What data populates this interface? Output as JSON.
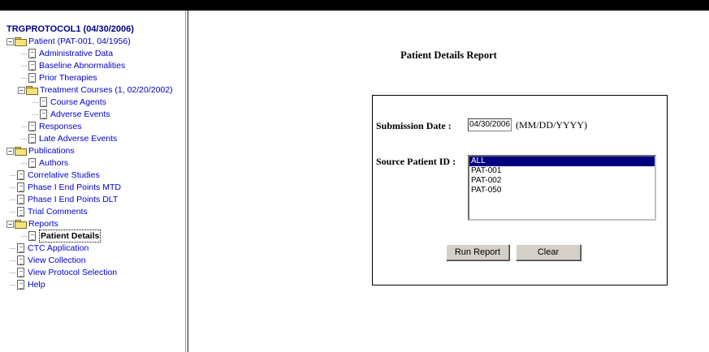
{
  "tree": {
    "title": "TRGPROTOCOL1 (04/30/2006)",
    "items": [
      {
        "label": "Patient (PAT-001, 04/1956)",
        "type": "folder",
        "level": 0,
        "expander": "−"
      },
      {
        "label": "Administrative Data",
        "type": "doc",
        "level": 1
      },
      {
        "label": "Baseline Abnormalities",
        "type": "doc",
        "level": 1
      },
      {
        "label": "Prior Therapies",
        "type": "doc",
        "level": 1
      },
      {
        "label": "Treatment Courses (1, 02/20/2002)",
        "type": "folder",
        "level": 1,
        "expander": "−"
      },
      {
        "label": "Course Agents",
        "type": "doc",
        "level": 2
      },
      {
        "label": "Adverse Events",
        "type": "doc",
        "level": 2
      },
      {
        "label": "Responses",
        "type": "doc",
        "level": 1
      },
      {
        "label": "Late Adverse Events",
        "type": "doc",
        "level": 1
      },
      {
        "label": "Publications",
        "type": "folder",
        "level": 0,
        "expander": "−"
      },
      {
        "label": "Authors",
        "type": "doc",
        "level": 1
      },
      {
        "label": "Correlative Studies",
        "type": "doc",
        "level": 0
      },
      {
        "label": "Phase I End Points MTD",
        "type": "doc",
        "level": 0
      },
      {
        "label": "Phase I End Points DLT",
        "type": "doc",
        "level": 0
      },
      {
        "label": "Trial Comments",
        "type": "doc",
        "level": 0
      },
      {
        "label": "Reports",
        "type": "folder",
        "level": 0,
        "expander": "−"
      },
      {
        "label": "Patient Details",
        "type": "doc",
        "level": 1,
        "selected": true
      },
      {
        "label": "CTC Application",
        "type": "doc",
        "level": 0
      },
      {
        "label": "View Collection",
        "type": "doc",
        "level": 0
      },
      {
        "label": "View Protocol Selection",
        "type": "doc",
        "level": 0
      },
      {
        "label": "Help",
        "type": "doc",
        "level": 0
      }
    ]
  },
  "report": {
    "title": "Patient Details Report",
    "submission_date_label": "Submission Date :",
    "submission_date_value": "04/30/2006",
    "date_format_hint": "(MM/DD/YYYY)",
    "source_patient_label": "Source Patient ID :",
    "patient_options": [
      "ALL",
      "PAT-001",
      "PAT-002",
      "PAT-050"
    ],
    "selected_option": "ALL",
    "run_button": "Run Report",
    "clear_button": "Clear"
  },
  "colors": {
    "tree_link": "#0000cc",
    "selection": "#000080",
    "button_face": "#d4d0c8"
  }
}
